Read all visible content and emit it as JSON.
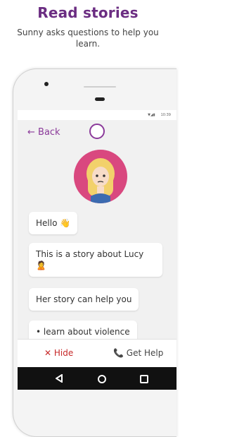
{
  "promo": {
    "title": "Read stories",
    "subtitle": "Sunny asks questions to help you learn."
  },
  "status_bar": {
    "time": "10:39"
  },
  "app_bar": {
    "back_label": "← Back",
    "logo_icon": "sunny-logo-icon"
  },
  "messages": [
    {
      "text": "Hello",
      "emoji": "👋"
    },
    {
      "text": "This is a story about Lucy",
      "emoji": "🙎"
    },
    {
      "text": "Her story can help you"
    },
    {
      "text": "•  learn about violence"
    }
  ],
  "actions": {
    "hide_label": "Hide",
    "hide_icon": "✕",
    "help_label": "Get Help",
    "help_icon": "📞"
  },
  "colors": {
    "brand": "#8b3a9a",
    "danger": "#c62828",
    "avatar_bg": "#d9487f"
  }
}
